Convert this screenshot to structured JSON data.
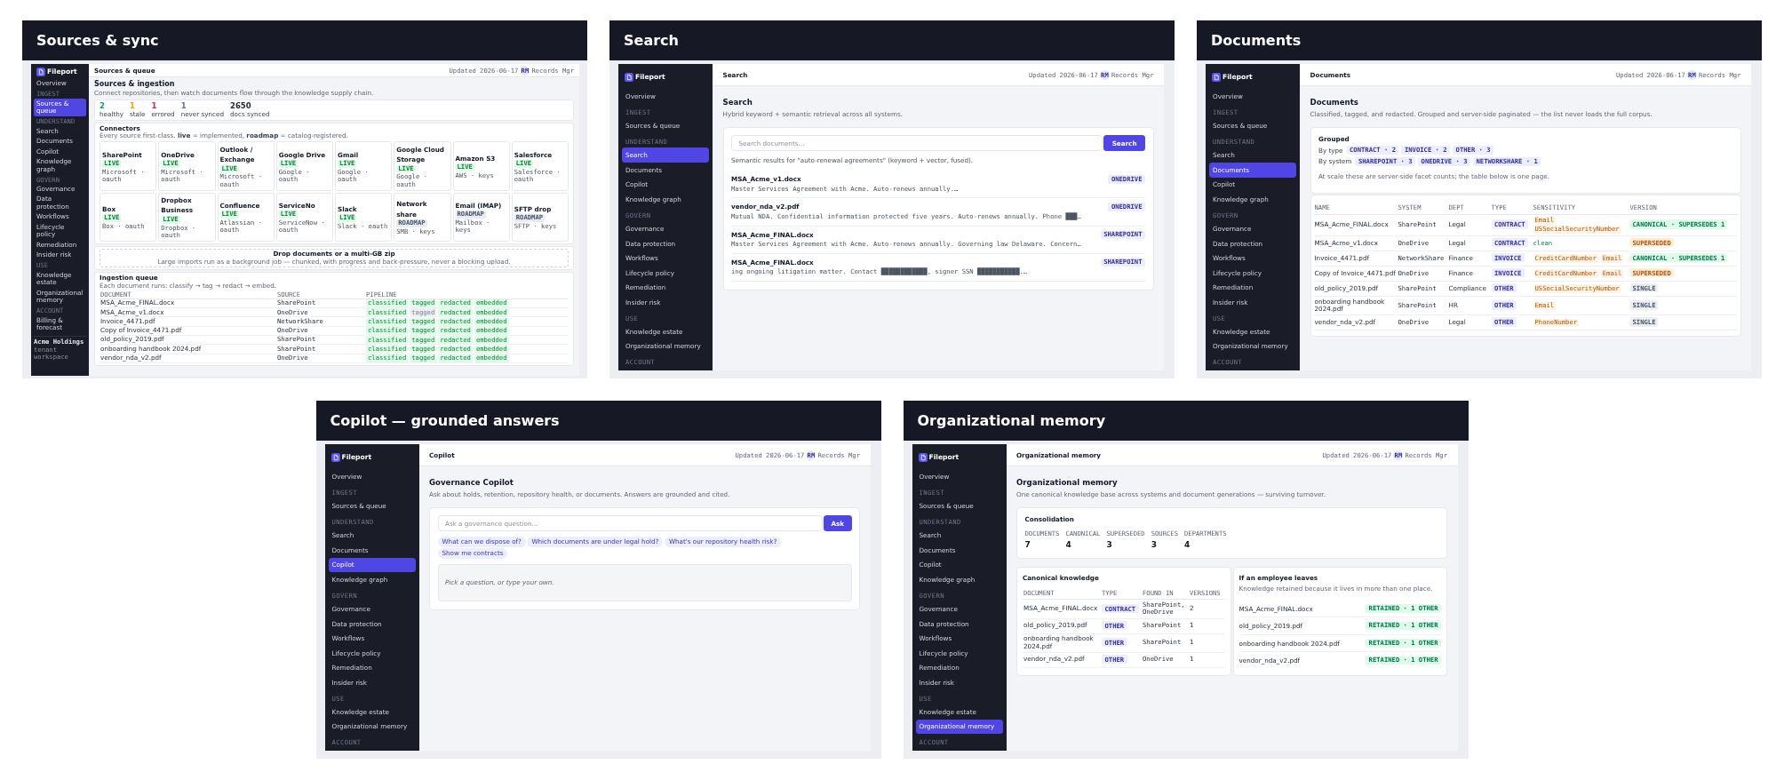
{
  "panels": [
    {
      "title": "Sources & sync",
      "app": {
        "sidebar": {
          "logo": "Fileport",
          "groups": [
            {
              "items": [
                {
                  "label": "Overview",
                  "selected": false
                }
              ]
            },
            {
              "heading": "INGEST",
              "items": [
                {
                  "label": "Sources & queue",
                  "selected": true
                }
              ]
            },
            {
              "heading": "UNDERSTAND",
              "items": [
                {
                  "label": "Search",
                  "selected": false
                },
                {
                  "label": "Documents",
                  "selected": false
                },
                {
                  "label": "Copilot",
                  "selected": false
                },
                {
                  "label": "Knowledge graph",
                  "selected": false
                }
              ]
            },
            {
              "heading": "GOVERN",
              "items": [
                {
                  "label": "Governance",
                  "selected": false
                },
                {
                  "label": "Data protection",
                  "selected": false
                },
                {
                  "label": "Workflows",
                  "selected": false
                },
                {
                  "label": "Lifecycle policy",
                  "selected": false
                },
                {
                  "label": "Remediation",
                  "selected": false
                },
                {
                  "label": "Insider risk",
                  "selected": false
                }
              ]
            },
            {
              "heading": "USE",
              "items": [
                {
                  "label": "Knowledge estate",
                  "selected": false
                },
                {
                  "label": "Organizational memory",
                  "selected": false
                }
              ]
            },
            {
              "heading": "ACCOUNT",
              "items": [
                {
                  "label": "Billing & forecast",
                  "selected": false
                }
              ]
            }
          ],
          "footer": {
            "org": "Acme Holdings",
            "note": "tenant workspace"
          }
        },
        "topbar": {
          "title": "Sources & queue",
          "updated": "Updated 2026-06-17",
          "avatar": "RM",
          "user": "Records Mgr"
        },
        "page": {
          "title": "Sources & ingestion",
          "subtitle": "Connect repositories, then watch documents flow through the knowledge supply chain."
        },
        "content": {
          "kind": "sources",
          "stats": [
            {
              "value": "2",
              "label": "healthy",
              "color": "#10a36a"
            },
            {
              "value": "1",
              "label": "stale",
              "color": "#f59e0b"
            },
            {
              "value": "1",
              "label": "errored",
              "color": "#e11d48"
            },
            {
              "value": "1",
              "label": "never synced",
              "color": "#64748b"
            },
            {
              "value": "2650",
              "label": "docs synced",
              "color": "#1f2937"
            }
          ],
          "connectors": {
            "title": "Connectors",
            "note": "Every source first-class. **live** = implemented, **roadmap** = catalog-registered.",
            "items": [
              {
                "name": "SharePoint",
                "status": "LIVE",
                "kind": "live",
                "auth": "Microsoft · oauth"
              },
              {
                "name": "OneDrive",
                "status": "LIVE",
                "kind": "live",
                "auth": "Microsoft · oauth"
              },
              {
                "name": "Outlook / Exchange",
                "status": "LIVE",
                "kind": "live",
                "auth": "Microsoft · oauth"
              },
              {
                "name": "Google Drive",
                "status": "LIVE",
                "kind": "live",
                "auth": "Google · oauth"
              },
              {
                "name": "Gmail",
                "status": "LIVE",
                "kind": "live",
                "auth": "Google · oauth"
              },
              {
                "name": "Google Cloud Storage",
                "status": "LIVE",
                "kind": "live",
                "auth": "Google · oauth"
              },
              {
                "name": "Amazon S3",
                "status": "LIVE",
                "kind": "live",
                "auth": "AWS · keys"
              },
              {
                "name": "Salesforce",
                "status": "LIVE",
                "kind": "live",
                "auth": "Salesforce · oauth"
              },
              {
                "name": "Box",
                "status": "LIVE",
                "kind": "live",
                "auth": "Box · oauth"
              },
              {
                "name": "Dropbox Business",
                "status": "LIVE",
                "kind": "live",
                "auth": "Dropbox · oauth"
              },
              {
                "name": "Confluence",
                "status": "LIVE",
                "kind": "live",
                "auth": "Atlassian · oauth"
              },
              {
                "name": "ServiceNo",
                "status": "LIVE",
                "kind": "live",
                "auth": "ServiceNow · oauth"
              },
              {
                "name": "Slack",
                "status": "LIVE",
                "kind": "live",
                "auth": "Slack · oauth"
              },
              {
                "name": "Network share",
                "status": "ROADMAP",
                "kind": "roadmap",
                "auth": "SMB · keys"
              },
              {
                "name": "Email (IMAP)",
                "status": "ROADMAP",
                "kind": "roadmap",
                "auth": "Mailbox · keys"
              },
              {
                "name": "SFTP drop",
                "status": "ROADMAP",
                "kind": "roadmap",
                "auth": "SFTP · keys"
              }
            ]
          },
          "dropzone": {
            "title": "Drop documents or a multi-GB zip",
            "note": "Large imports run as a background job — chunked, with progress and back-pressure, never a blocking upload."
          },
          "queue": {
            "title": "Ingestion queue",
            "note": "Each document runs: classify → tag → redact → embed.",
            "columns": [
              "DOCUMENT",
              "SOURCE",
              "PIPELINE"
            ],
            "rows": [
              {
                "document": "MSA_Acme_FINAL.docx",
                "source": "SharePoint",
                "steps": [
                  {
                    "label": "classified",
                    "done": true
                  },
                  {
                    "label": "tagged",
                    "done": true
                  },
                  {
                    "label": "redacted",
                    "done": true
                  },
                  {
                    "label": "embedded",
                    "done": true
                  }
                ]
              },
              {
                "document": "MSA_Acme_v1.docx",
                "source": "OneDrive",
                "steps": [
                  {
                    "label": "classified",
                    "done": true
                  },
                  {
                    "label": "tagged",
                    "done": false
                  },
                  {
                    "label": "redacted",
                    "done": true
                  },
                  {
                    "label": "embedded",
                    "done": true
                  }
                ]
              },
              {
                "document": "Invoice_4471.pdf",
                "source": "NetworkShare",
                "steps": [
                  {
                    "label": "classified",
                    "done": true
                  },
                  {
                    "label": "tagged",
                    "done": true
                  },
                  {
                    "label": "redacted",
                    "done": true
                  },
                  {
                    "label": "embedded",
                    "done": true
                  }
                ]
              },
              {
                "document": "Copy of Invoice_4471.pdf",
                "source": "OneDrive",
                "steps": [
                  {
                    "label": "classified",
                    "done": true
                  },
                  {
                    "label": "tagged",
                    "done": true
                  },
                  {
                    "label": "redacted",
                    "done": true
                  },
                  {
                    "label": "embedded",
                    "done": true
                  }
                ]
              },
              {
                "document": "old_policy_2019.pdf",
                "source": "SharePoint",
                "steps": [
                  {
                    "label": "classified",
                    "done": true
                  },
                  {
                    "label": "tagged",
                    "done": true
                  },
                  {
                    "label": "redacted",
                    "done": true
                  },
                  {
                    "label": "embedded",
                    "done": true
                  }
                ]
              },
              {
                "document": "onboarding handbook 2024.pdf",
                "source": "SharePoint",
                "steps": [
                  {
                    "label": "classified",
                    "done": true
                  },
                  {
                    "label": "tagged",
                    "done": true
                  },
                  {
                    "label": "redacted",
                    "done": true
                  },
                  {
                    "label": "embedded",
                    "done": true
                  }
                ]
              },
              {
                "document": "vendor_nda_v2.pdf",
                "source": "OneDrive",
                "steps": [
                  {
                    "label": "classified",
                    "done": true
                  },
                  {
                    "label": "tagged",
                    "done": true
                  },
                  {
                    "label": "redacted",
                    "done": true
                  },
                  {
                    "label": "embedded",
                    "done": true
                  }
                ]
              }
            ]
          }
        }
      }
    },
    {
      "title": "Search",
      "app": {
        "sidebar": {
          "logo": "Fileport",
          "groups": [
            {
              "items": [
                {
                  "label": "Overview",
                  "selected": false
                }
              ]
            },
            {
              "heading": "INGEST",
              "items": [
                {
                  "label": "Sources & queue",
                  "selected": false
                }
              ]
            },
            {
              "heading": "UNDERSTAND",
              "items": [
                {
                  "label": "Search",
                  "selected": true
                },
                {
                  "label": "Documents",
                  "selected": false
                },
                {
                  "label": "Copilot",
                  "selected": false
                },
                {
                  "label": "Knowledge graph",
                  "selected": false
                }
              ]
            },
            {
              "heading": "GOVERN",
              "items": [
                {
                  "label": "Governance",
                  "selected": false
                },
                {
                  "label": "Data protection",
                  "selected": false
                },
                {
                  "label": "Workflows",
                  "selected": false
                },
                {
                  "label": "Lifecycle policy",
                  "selected": false
                },
                {
                  "label": "Remediation",
                  "selected": false
                },
                {
                  "label": "Insider risk",
                  "selected": false
                }
              ]
            },
            {
              "heading": "USE",
              "items": [
                {
                  "label": "Knowledge estate",
                  "selected": false
                },
                {
                  "label": "Organizational memory",
                  "selected": false
                }
              ]
            },
            {
              "heading": "ACCOUNT"
            }
          ]
        },
        "topbar": {
          "title": "Search",
          "updated": "Updated 2026-06-17",
          "avatar": "RM",
          "user": "Records Mgr"
        },
        "page": {
          "title": "Search",
          "subtitle": "Hybrid keyword + semantic retrieval across all systems."
        },
        "content": {
          "kind": "search",
          "placeholder": "Search documents…",
          "button": "Search",
          "summary": "Semantic results for \"auto-renewal agreements\" (keyword + vector, fused).",
          "results": [
            {
              "title": "MSA_Acme_v1.docx",
              "source": "ONEDRIVE",
              "snippet": "Master Services Agreement with Acme. Auto-renews annually.…"
            },
            {
              "title": "vendor_nda_v2.pdf",
              "source": "ONEDRIVE",
              "snippet": "Mutual NDA. Confidential information protected five years. Auto-renews annually. Phone ███…"
            },
            {
              "title": "MSA_Acme_FINAL.docx",
              "source": "SHAREPOINT",
              "snippet": "Master Services Agreement with Acme. Auto-renews annually. Governing law Delaware. Concern…"
            },
            {
              "title": "MSA_Acme_FINAL.docx",
              "source": "SHAREPOINT",
              "snippet": "ing ongoing litigation matter. Contact ████████████, signer SSN ███████████.…"
            }
          ]
        }
      }
    },
    {
      "title": "Documents",
      "app": {
        "sidebar": {
          "logo": "Fileport",
          "groups": [
            {
              "items": [
                {
                  "label": "Overview",
                  "selected": false
                }
              ]
            },
            {
              "heading": "INGEST",
              "items": [
                {
                  "label": "Sources & queue",
                  "selected": false
                }
              ]
            },
            {
              "heading": "UNDERSTAND",
              "items": [
                {
                  "label": "Search",
                  "selected": false
                },
                {
                  "label": "Documents",
                  "selected": true
                },
                {
                  "label": "Copilot",
                  "selected": false
                },
                {
                  "label": "Knowledge graph",
                  "selected": false
                }
              ]
            },
            {
              "heading": "GOVERN",
              "items": [
                {
                  "label": "Governance",
                  "selected": false
                },
                {
                  "label": "Data protection",
                  "selected": false
                },
                {
                  "label": "Workflows",
                  "selected": false
                },
                {
                  "label": "Lifecycle policy",
                  "selected": false
                },
                {
                  "label": "Remediation",
                  "selected": false
                },
                {
                  "label": "Insider risk",
                  "selected": false
                }
              ]
            },
            {
              "heading": "USE",
              "items": [
                {
                  "label": "Knowledge estate",
                  "selected": false
                },
                {
                  "label": "Organizational memory",
                  "selected": false
                }
              ]
            },
            {
              "heading": "ACCOUNT"
            }
          ]
        },
        "topbar": {
          "title": "Documents",
          "updated": "Updated 2026-06-17",
          "avatar": "RM",
          "user": "Records Mgr"
        },
        "page": {
          "title": "Documents",
          "subtitle": "Classified, tagged, and redacted. Grouped and server-side paginated — the list never loads the full corpus."
        },
        "content": {
          "kind": "documents",
          "grouped": {
            "title": "Grouped",
            "facets": [
              {
                "label": "By type",
                "chips": [
                  "CONTRACT · 2",
                  "INVOICE · 2",
                  "OTHER · 3"
                ]
              },
              {
                "label": "By system",
                "chips": [
                  "SHAREPOINT · 3",
                  "ONEDRIVE · 3",
                  "NETWORKSHARE · 1"
                ]
              }
            ],
            "note": "At scale these are server-side facet counts; the table below is one page."
          },
          "table": {
            "columns": [
              "NAME",
              "SYSTEM",
              "DEPT",
              "TYPE",
              "SENSITIVITY",
              "VERSION"
            ],
            "rows": [
              {
                "name": "MSA_Acme_FINAL.docx",
                "system": "SharePoint",
                "dept": "Legal",
                "type": "CONTRACT",
                "sensitivity": [
                  {
                    "label": "Email",
                    "kind": "pii"
                  },
                  {
                    "label": "USSocialSecurityNumber",
                    "kind": "pii"
                  }
                ],
                "version": {
                  "label": "CANONICAL · SUPERSEDES 1",
                  "kind": "canonical"
                }
              },
              {
                "name": "MSA_Acme_v1.docx",
                "system": "OneDrive",
                "dept": "Legal",
                "type": "CONTRACT",
                "sensitivity": [
                  {
                    "label": "clean",
                    "kind": "clean"
                  }
                ],
                "version": {
                  "label": "SUPERSEDED",
                  "kind": "superseded"
                }
              },
              {
                "name": "Invoice_4471.pdf",
                "system": "NetworkShare",
                "dept": "Finance",
                "type": "INVOICE",
                "sensitivity": [
                  {
                    "label": "CreditCardNumber",
                    "kind": "pii"
                  },
                  {
                    "label": "Email",
                    "kind": "pii"
                  }
                ],
                "version": {
                  "label": "CANONICAL · SUPERSEDES 1",
                  "kind": "canonical"
                }
              },
              {
                "name": "Copy of Invoice_4471.pdf",
                "system": "OneDrive",
                "dept": "Finance",
                "type": "INVOICE",
                "sensitivity": [
                  {
                    "label": "CreditCardNumber",
                    "kind": "pii"
                  },
                  {
                    "label": "Email",
                    "kind": "pii"
                  }
                ],
                "version": {
                  "label": "SUPERSEDED",
                  "kind": "superseded"
                }
              },
              {
                "name": "old_policy_2019.pdf",
                "system": "SharePoint",
                "dept": "Compliance",
                "type": "OTHER",
                "sensitivity": [
                  {
                    "label": "USSocialSecurityNumber",
                    "kind": "pii"
                  }
                ],
                "version": {
                  "label": "SINGLE",
                  "kind": "single"
                }
              },
              {
                "name": "onboarding handbook 2024.pdf",
                "system": "SharePoint",
                "dept": "HR",
                "type": "OTHER",
                "sensitivity": [
                  {
                    "label": "Email",
                    "kind": "pii"
                  }
                ],
                "version": {
                  "label": "SINGLE",
                  "kind": "single"
                }
              },
              {
                "name": "vendor_nda_v2.pdf",
                "system": "OneDrive",
                "dept": "Legal",
                "type": "OTHER",
                "sensitivity": [
                  {
                    "label": "PhoneNumber",
                    "kind": "pii"
                  }
                ],
                "version": {
                  "label": "SINGLE",
                  "kind": "single"
                }
              }
            ]
          }
        }
      }
    },
    {
      "title": "Copilot — grounded answers",
      "app": {
        "sidebar": {
          "logo": "Fileport",
          "groups": [
            {
              "items": [
                {
                  "label": "Overview",
                  "selected": false
                }
              ]
            },
            {
              "heading": "INGEST",
              "items": [
                {
                  "label": "Sources & queue",
                  "selected": false
                }
              ]
            },
            {
              "heading": "UNDERSTAND",
              "items": [
                {
                  "label": "Search",
                  "selected": false
                },
                {
                  "label": "Documents",
                  "selected": false
                },
                {
                  "label": "Copilot",
                  "selected": true
                },
                {
                  "label": "Knowledge graph",
                  "selected": false
                }
              ]
            },
            {
              "heading": "GOVERN",
              "items": [
                {
                  "label": "Governance",
                  "selected": false
                },
                {
                  "label": "Data protection",
                  "selected": false
                },
                {
                  "label": "Workflows",
                  "selected": false
                },
                {
                  "label": "Lifecycle policy",
                  "selected": false
                },
                {
                  "label": "Remediation",
                  "selected": false
                },
                {
                  "label": "Insider risk",
                  "selected": false
                }
              ]
            },
            {
              "heading": "USE",
              "items": [
                {
                  "label": "Knowledge estate",
                  "selected": false
                },
                {
                  "label": "Organizational memory",
                  "selected": false
                }
              ]
            },
            {
              "heading": "ACCOUNT"
            }
          ]
        },
        "topbar": {
          "title": "Copilot",
          "updated": "Updated 2026-06-17",
          "avatar": "RM",
          "user": "Records Mgr"
        },
        "page": {
          "title": "Governance Copilot",
          "subtitle": "Ask about holds, retention, repository health, or documents. Answers are grounded and cited."
        },
        "content": {
          "kind": "copilot",
          "placeholder": "Ask a governance question…",
          "button": "Ask",
          "suggestions": [
            "What can we dispose of?",
            "Which documents are under legal hold?",
            "What's our repository health risk?",
            "Show me contracts"
          ],
          "answer_hint": "Pick a question, or type your own."
        }
      }
    },
    {
      "title": "Organizational memory",
      "app": {
        "sidebar": {
          "logo": "Fileport",
          "groups": [
            {
              "items": [
                {
                  "label": "Overview",
                  "selected": false
                }
              ]
            },
            {
              "heading": "INGEST",
              "items": [
                {
                  "label": "Sources & queue",
                  "selected": false
                }
              ]
            },
            {
              "heading": "UNDERSTAND",
              "items": [
                {
                  "label": "Search",
                  "selected": false
                },
                {
                  "label": "Documents",
                  "selected": false
                },
                {
                  "label": "Copilot",
                  "selected": false
                },
                {
                  "label": "Knowledge graph",
                  "selected": false
                }
              ]
            },
            {
              "heading": "GOVERN",
              "items": [
                {
                  "label": "Governance",
                  "selected": false
                },
                {
                  "label": "Data protection",
                  "selected": false
                },
                {
                  "label": "Workflows",
                  "selected": false
                },
                {
                  "label": "Lifecycle policy",
                  "selected": false
                },
                {
                  "label": "Remediation",
                  "selected": false
                },
                {
                  "label": "Insider risk",
                  "selected": false
                }
              ]
            },
            {
              "heading": "USE",
              "items": [
                {
                  "label": "Knowledge estate",
                  "selected": false
                },
                {
                  "label": "Organizational memory",
                  "selected": true
                }
              ]
            },
            {
              "heading": "ACCOUNT"
            }
          ]
        },
        "topbar": {
          "title": "Organizational memory",
          "updated": "Updated 2026-06-17",
          "avatar": "RM",
          "user": "Records Mgr"
        },
        "page": {
          "title": "Organizational memory",
          "subtitle": "One canonical knowledge base across systems and document generations — surviving turnover."
        },
        "content": {
          "kind": "memory",
          "consolidation": {
            "title": "Consolidation",
            "stats": [
              {
                "label": "DOCUMENTS",
                "value": "7"
              },
              {
                "label": "CANONICAL",
                "value": "4"
              },
              {
                "label": "SUPERSEDED",
                "value": "3"
              },
              {
                "label": "SOURCES",
                "value": "3"
              },
              {
                "label": "DEPARTMENTS",
                "value": "4"
              }
            ]
          },
          "canonical": {
            "title": "Canonical knowledge",
            "columns": [
              "DOCUMENT",
              "TYPE",
              "FOUND IN",
              "VERSIONS"
            ],
            "rows": [
              {
                "document": "MSA_Acme_FINAL.docx",
                "type": "CONTRACT",
                "found_in": "SharePoint, OneDrive",
                "versions": "2"
              },
              {
                "document": "old_policy_2019.pdf",
                "type": "OTHER",
                "found_in": "SharePoint",
                "versions": "1"
              },
              {
                "document": "onboarding handbook 2024.pdf",
                "type": "OTHER",
                "found_in": "SharePoint",
                "versions": "1"
              },
              {
                "document": "vendor_nda_v2.pdf",
                "type": "OTHER",
                "found_in": "OneDrive",
                "versions": "1"
              }
            ]
          },
          "retention": {
            "title": "If an employee leaves",
            "note": "Knowledge retained because it lives in more than one place.",
            "items": [
              {
                "document": "MSA_Acme_FINAL.docx",
                "badge": "RETAINED · 1 OTHER"
              },
              {
                "document": "old_policy_2019.pdf",
                "badge": "RETAINED · 1 OTHER"
              },
              {
                "document": "onboarding handbook 2024.pdf",
                "badge": "RETAINED · 1 OTHER"
              },
              {
                "document": "vendor_nda_v2.pdf",
                "badge": "RETAINED · 1 OTHER"
              }
            ]
          }
        }
      }
    }
  ]
}
